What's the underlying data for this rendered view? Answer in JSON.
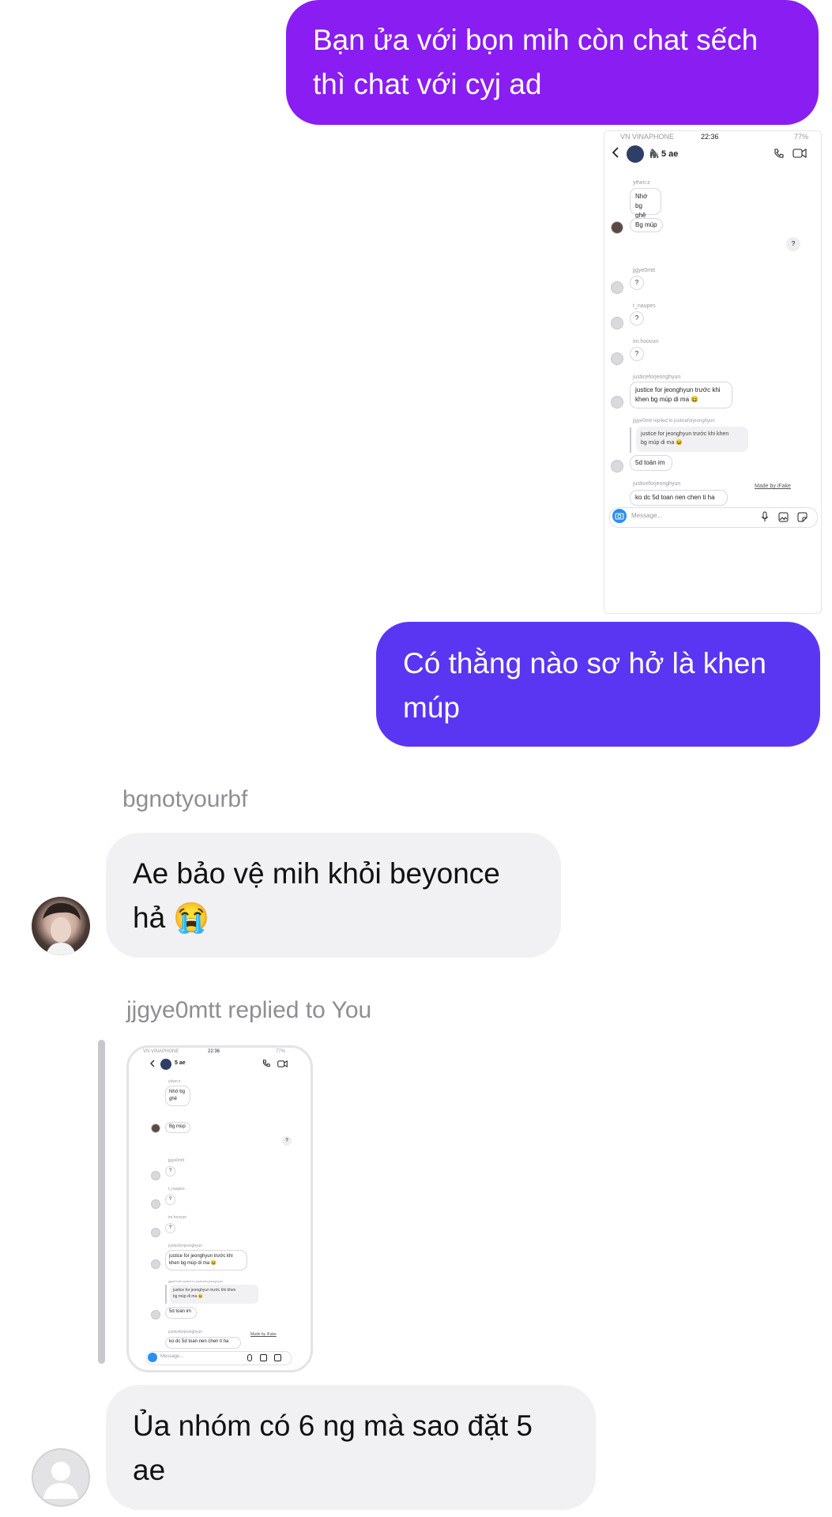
{
  "messages": {
    "out1": {
      "line1": "Bạn ửa với bọn mih còn chat sếch",
      "line2": "thì chat với cyj ad"
    },
    "out2": {
      "line1": "Có thằng nào sơ hở là khen",
      "line2": "múp"
    },
    "in1": {
      "sender": "bgnotyourbf",
      "line1": "Ae bảo vệ mih khỏi beyonce",
      "line2": "hả 😭"
    },
    "reply": {
      "header": "jjgye0mtt replied to You"
    },
    "in2": {
      "line1": "Ủa nhóm có 6 ng mà sao đặt 5",
      "line2": "ae"
    }
  },
  "screenshot": {
    "carrier": "VN VINAPHONE",
    "time": "22:36",
    "battery": "77%",
    "group_name": "5 ae",
    "group_emoji": "🦍",
    "sender_yahan": "yěwn:z",
    "msg_nho": "Nhớ bg ghê",
    "msg_nho_l1": "Nhớ bg",
    "msg_nho_l2": "ghê",
    "msg_bgmup": "Bg múp",
    "msg_q_right": "?",
    "sender_jjg": "jjgye0mtt",
    "msg_q1": "?",
    "sender_t": "t_naupes",
    "msg_q2": "?",
    "sender_im": "im.hoovun",
    "msg_q3": "?",
    "sender_justice": "justiceforjeonghyun",
    "msg_justice_l1": "justice for jeonghyun trước khi",
    "msg_justice_l2": "khen bg múp di ma 😆",
    "reply_label": "jjgye0mtt replied to justiceforjeonghyun",
    "reply_quote_l1": "justice for jeonghyun trước khi khen",
    "reply_quote_l2": "bg múp di ma 😆",
    "msg_5d": "5d toán im",
    "sender_justice2": "justiceforjeonghyun",
    "msg_ko": "ko dc 5d toan nen chen ti ha",
    "made_by": "Made by iFake",
    "message_placeholder": "Message..."
  },
  "colors": {
    "out1": "#8a1df2",
    "out2": "#5a36f2",
    "incoming": "#f1f1f3",
    "sender_gray": "#8e8e93"
  }
}
